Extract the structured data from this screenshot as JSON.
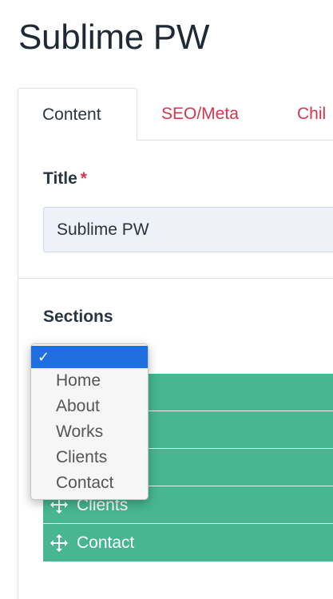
{
  "page": {
    "title": "Sublime PW"
  },
  "tabs": [
    {
      "label": "Content"
    },
    {
      "label": "SEO/Meta"
    },
    {
      "label": "Chil"
    }
  ],
  "title_field": {
    "label": "Title",
    "required_mark": "*",
    "value": "Sublime PW"
  },
  "sections": {
    "label": "Sections",
    "rows": [
      {
        "label": ""
      },
      {
        "label": ""
      },
      {
        "label": ""
      },
      {
        "label": "Clients"
      },
      {
        "label": "Contact"
      }
    ]
  },
  "dropdown": {
    "check": "✓",
    "options": [
      "Home",
      "About",
      "Works",
      "Clients",
      "Contact"
    ]
  },
  "colors": {
    "accent": "#47b691",
    "link": "#d4364e",
    "selection": "#1f6fe0"
  }
}
